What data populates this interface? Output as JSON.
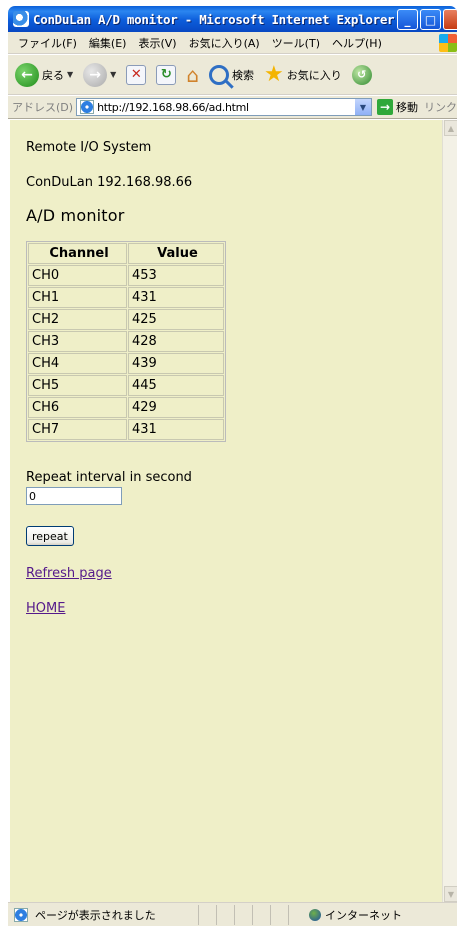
{
  "window": {
    "title": "ConDuLan A/D monitor - Microsoft Internet Explorer",
    "minimize_label": "_",
    "maximize_label": "□"
  },
  "menu": {
    "items": [
      "ファイル(F)",
      "編集(E)",
      "表示(V)",
      "お気に入り(A)",
      "ツール(T)",
      "ヘルプ(H)"
    ]
  },
  "toolbar": {
    "back_label": "戻る",
    "search_label": "検索",
    "favorites_label": "お気に入り"
  },
  "addressbar": {
    "label": "アドレス(D)",
    "url": "http://192.168.98.66/ad.html",
    "go_label": "移動",
    "links_label": "リンク"
  },
  "page": {
    "system_name": "Remote I/O System",
    "device": "ConDuLan 192.168.98.66",
    "heading": "A/D monitor",
    "table": {
      "headers": [
        "Channel",
        "Value"
      ],
      "rows": [
        [
          "CH0",
          "453"
        ],
        [
          "CH1",
          "431"
        ],
        [
          "CH2",
          "425"
        ],
        [
          "CH3",
          "428"
        ],
        [
          "CH4",
          "439"
        ],
        [
          "CH5",
          "445"
        ],
        [
          "CH6",
          "429"
        ],
        [
          "CH7",
          "431"
        ]
      ]
    },
    "interval_label": "Repeat interval in second",
    "interval_value": "0",
    "repeat_button": "repeat",
    "refresh_link": "Refresh page",
    "home_link": "HOME"
  },
  "statusbar": {
    "message": "ページが表示されました",
    "zone": "インターネット"
  }
}
